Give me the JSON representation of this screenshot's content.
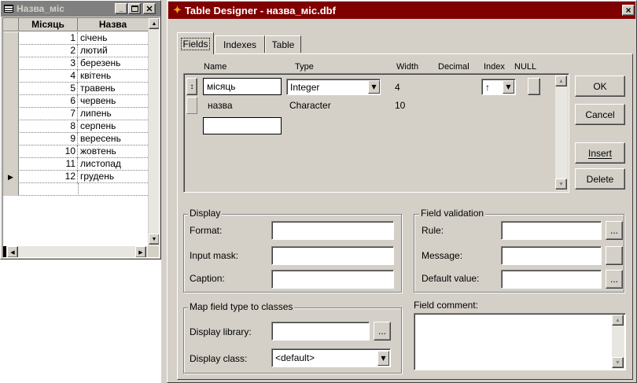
{
  "browse_window": {
    "title": "Назва_міс",
    "columns": [
      "Місяць",
      "Назва"
    ],
    "rows": [
      {
        "n": "1",
        "name": "січень"
      },
      {
        "n": "2",
        "name": "лютий"
      },
      {
        "n": "3",
        "name": "березень"
      },
      {
        "n": "4",
        "name": "квітень"
      },
      {
        "n": "5",
        "name": "травень"
      },
      {
        "n": "6",
        "name": "червень"
      },
      {
        "n": "7",
        "name": "липень"
      },
      {
        "n": "8",
        "name": "серпень"
      },
      {
        "n": "9",
        "name": "вересень"
      },
      {
        "n": "10",
        "name": "жовтень"
      },
      {
        "n": "11",
        "name": "листопад"
      },
      {
        "n": "12",
        "name": "грудень"
      }
    ],
    "current_row": 11
  },
  "designer": {
    "title": "Table Designer - назва_міс.dbf",
    "close": "×",
    "tabs": [
      "Fields",
      "Indexes",
      "Table"
    ],
    "active_tab": 0,
    "headers": {
      "name": "Name",
      "type": "Type",
      "width": "Width",
      "decimal": "Decimal",
      "index": "Index",
      "null": "NULL"
    },
    "fields": [
      {
        "name": "місяць",
        "type": "Integer",
        "width": "4",
        "index": "↑"
      },
      {
        "name": "назва",
        "type": "Character",
        "width": "10",
        "index": ""
      }
    ],
    "buttons": {
      "ok": "OK",
      "cancel": "Cancel",
      "insert": "Insert",
      "delete": "Delete"
    },
    "display": {
      "group": "Display",
      "format": "Format:",
      "input_mask": "Input mask:",
      "caption": "Caption:"
    },
    "validation": {
      "group": "Field validation",
      "rule": "Rule:",
      "message": "Message:",
      "default_value": "Default value:",
      "ellipsis": "..."
    },
    "map": {
      "group": "Map field type to classes",
      "library": "Display library:",
      "class": "Display class:",
      "class_value": "<default>",
      "ellipsis": "..."
    },
    "comment": {
      "label": "Field comment:"
    }
  },
  "colors": {
    "title_active": "#800000",
    "title_inactive": "#808080",
    "face": "#d4d0c8"
  }
}
